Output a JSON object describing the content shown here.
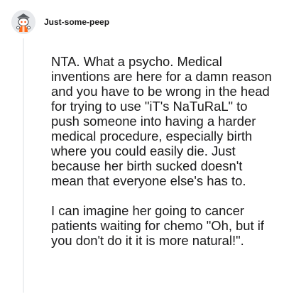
{
  "post": {
    "username": "Just-some-peep",
    "avatar_icon": "snoo-avatar-icon",
    "paragraphs": [
      "NTA. What a psycho. Medical inventions are here for a damn reason and you have to be wrong in the head for trying to use \"iT's NaTuRaL\" to push someone into having a harder medical procedure, especially birth where you could easily die. Just because her birth sucked doesn't mean that everyone else's has to.",
      "I can imagine her going to cancer patients waiting for chemo \"Oh, but if you don't do it it is more natural!\"."
    ]
  },
  "colors": {
    "text": "#1a1a1b",
    "thread_line": "#edeff1",
    "avatar_bg": "#e7e9ec",
    "avatar_accent": "#ff4500"
  }
}
